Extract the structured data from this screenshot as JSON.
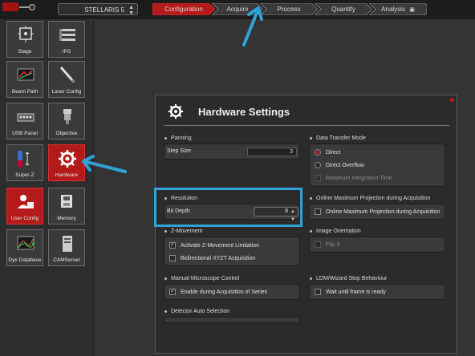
{
  "top": {
    "instrument": "STELLARIS 5",
    "workflow": [
      {
        "label": "Configuration",
        "active": true
      },
      {
        "label": "Acquire",
        "active": false
      },
      {
        "label": "Process",
        "active": false
      },
      {
        "label": "Quantify",
        "active": false
      },
      {
        "label": "Analysis",
        "active": false
      }
    ]
  },
  "sidebar": {
    "tiles": [
      {
        "label": "Stage",
        "icon": "stage-icon"
      },
      {
        "label": "IPS",
        "icon": "ips-icon"
      },
      {
        "label": "Beam Path",
        "icon": "beam-path-icon"
      },
      {
        "label": "Laser Config",
        "icon": "laser-config-icon"
      },
      {
        "label": "USB Panel",
        "icon": "usb-panel-icon"
      },
      {
        "label": "Objective",
        "icon": "objective-icon"
      },
      {
        "label": "Super-Z",
        "icon": "super-z-icon"
      },
      {
        "label": "Hardware",
        "icon": "gear-icon",
        "active": true
      },
      {
        "label": "User Config",
        "icon": "user-config-icon",
        "active": true
      },
      {
        "label": "Memory",
        "icon": "memory-icon"
      },
      {
        "label": "Dye Database",
        "icon": "dye-database-icon"
      },
      {
        "label": "CAMServer",
        "icon": "camserver-icon"
      }
    ]
  },
  "panel": {
    "title": "Hardware Settings",
    "panning": {
      "heading": "Panning",
      "step_size_label": "Step Size",
      "step_size_value": "3"
    },
    "data_transfer": {
      "heading": "Data Transfer Mode",
      "direct": "Direct",
      "direct_overflow": "Direct Overflow",
      "max_integration": "Maximum Integration Time"
    },
    "resolution": {
      "heading": "Resolution",
      "bit_depth_label": "Bit Depth",
      "bit_depth_value": "8"
    },
    "online_max": {
      "heading": "Online Maximum Projection during Acquisition",
      "option": "Online Maximum Projection during Acquisition"
    },
    "z_movement": {
      "heading": "Z-Movement",
      "activate": "Activate Z-Movement Limitation",
      "bidirectional": "Bidirectional XYZT Acquisition"
    },
    "image_orientation": {
      "heading": "Image Orientation",
      "flip_x": "Flip X"
    },
    "manual_control": {
      "heading": "Manual Microscope Control",
      "enable": "Enable during Acquisition of Series"
    },
    "ldm": {
      "heading": "LDM/Wizard Stop Behaviour",
      "wait": "Wait until frame is ready"
    },
    "detector": {
      "heading": "Detector Auto Selection"
    }
  },
  "colors": {
    "accent_red": "#b51a1a",
    "highlight_blue": "#2fa3d6"
  }
}
